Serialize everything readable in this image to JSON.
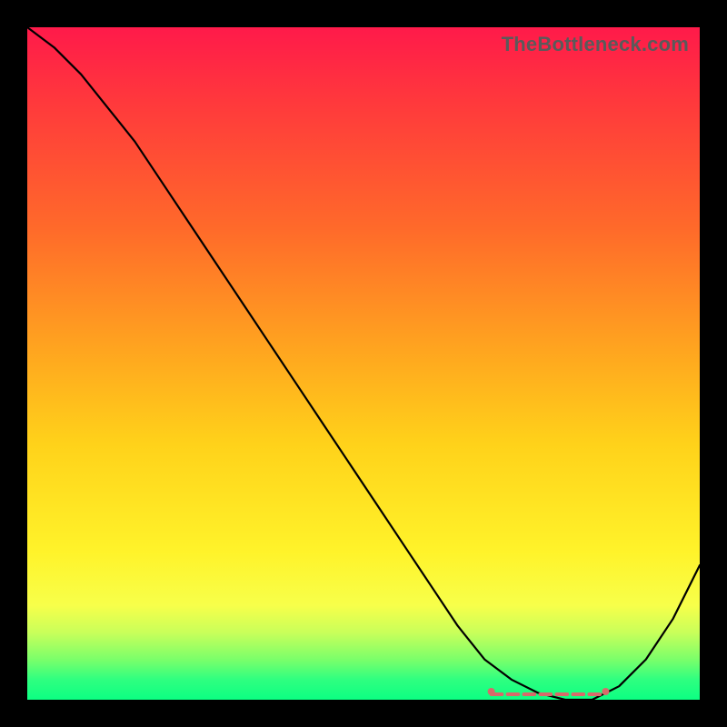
{
  "watermark": "TheBottleneck.com",
  "chart_data": {
    "type": "line",
    "title": "",
    "xlabel": "",
    "ylabel": "",
    "xlim": [
      0,
      100
    ],
    "ylim": [
      0,
      100
    ],
    "grid": false,
    "series": [
      {
        "name": "bottleneck-curve",
        "x": [
          0,
          4,
          8,
          12,
          16,
          20,
          24,
          28,
          32,
          36,
          40,
          44,
          48,
          52,
          56,
          60,
          64,
          68,
          72,
          76,
          80,
          84,
          88,
          92,
          96,
          100
        ],
        "values": [
          100,
          97,
          93,
          88,
          83,
          77,
          71,
          65,
          59,
          53,
          47,
          41,
          35,
          29,
          23,
          17,
          11,
          6,
          3,
          1,
          0,
          0,
          2,
          6,
          12,
          20
        ]
      }
    ],
    "highlight": {
      "name": "optimal-range",
      "x_start": 69,
      "x_end": 86,
      "y": 0,
      "color": "#d86a6a"
    },
    "background_gradient": {
      "stops": [
        {
          "pos": 0,
          "color": "#ff1a4a"
        },
        {
          "pos": 50,
          "color": "#ffd21a"
        },
        {
          "pos": 80,
          "color": "#fff32a"
        },
        {
          "pos": 100,
          "color": "#0cff82"
        }
      ]
    }
  }
}
